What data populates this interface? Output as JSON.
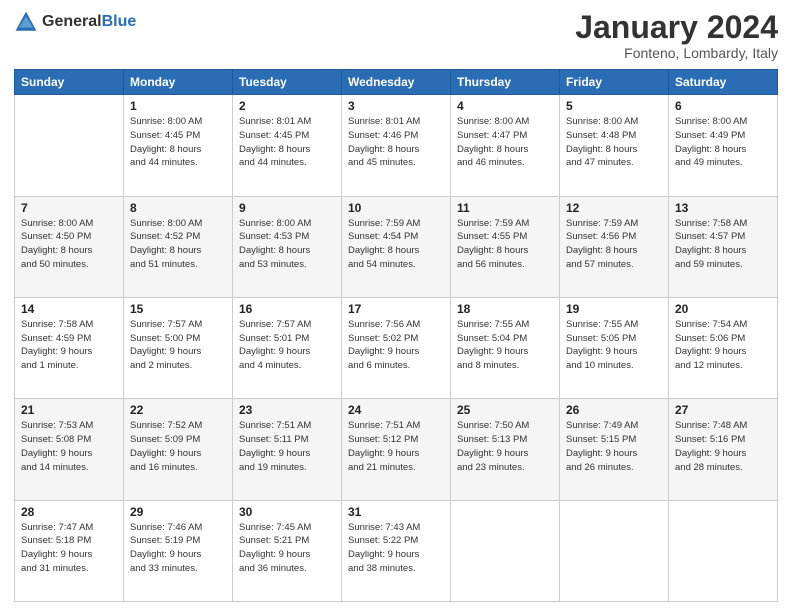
{
  "logo": {
    "general": "General",
    "blue": "Blue"
  },
  "header": {
    "month": "January 2024",
    "location": "Fonteno, Lombardy, Italy"
  },
  "weekdays": [
    "Sunday",
    "Monday",
    "Tuesday",
    "Wednesday",
    "Thursday",
    "Friday",
    "Saturday"
  ],
  "weeks": [
    [
      {
        "day": "",
        "info": ""
      },
      {
        "day": "1",
        "info": "Sunrise: 8:00 AM\nSunset: 4:45 PM\nDaylight: 8 hours\nand 44 minutes."
      },
      {
        "day": "2",
        "info": "Sunrise: 8:01 AM\nSunset: 4:45 PM\nDaylight: 8 hours\nand 44 minutes."
      },
      {
        "day": "3",
        "info": "Sunrise: 8:01 AM\nSunset: 4:46 PM\nDaylight: 8 hours\nand 45 minutes."
      },
      {
        "day": "4",
        "info": "Sunrise: 8:00 AM\nSunset: 4:47 PM\nDaylight: 8 hours\nand 46 minutes."
      },
      {
        "day": "5",
        "info": "Sunrise: 8:00 AM\nSunset: 4:48 PM\nDaylight: 8 hours\nand 47 minutes."
      },
      {
        "day": "6",
        "info": "Sunrise: 8:00 AM\nSunset: 4:49 PM\nDaylight: 8 hours\nand 49 minutes."
      }
    ],
    [
      {
        "day": "7",
        "info": "Sunrise: 8:00 AM\nSunset: 4:50 PM\nDaylight: 8 hours\nand 50 minutes."
      },
      {
        "day": "8",
        "info": "Sunrise: 8:00 AM\nSunset: 4:52 PM\nDaylight: 8 hours\nand 51 minutes."
      },
      {
        "day": "9",
        "info": "Sunrise: 8:00 AM\nSunset: 4:53 PM\nDaylight: 8 hours\nand 53 minutes."
      },
      {
        "day": "10",
        "info": "Sunrise: 7:59 AM\nSunset: 4:54 PM\nDaylight: 8 hours\nand 54 minutes."
      },
      {
        "day": "11",
        "info": "Sunrise: 7:59 AM\nSunset: 4:55 PM\nDaylight: 8 hours\nand 56 minutes."
      },
      {
        "day": "12",
        "info": "Sunrise: 7:59 AM\nSunset: 4:56 PM\nDaylight: 8 hours\nand 57 minutes."
      },
      {
        "day": "13",
        "info": "Sunrise: 7:58 AM\nSunset: 4:57 PM\nDaylight: 8 hours\nand 59 minutes."
      }
    ],
    [
      {
        "day": "14",
        "info": "Sunrise: 7:58 AM\nSunset: 4:59 PM\nDaylight: 9 hours\nand 1 minute."
      },
      {
        "day": "15",
        "info": "Sunrise: 7:57 AM\nSunset: 5:00 PM\nDaylight: 9 hours\nand 2 minutes."
      },
      {
        "day": "16",
        "info": "Sunrise: 7:57 AM\nSunset: 5:01 PM\nDaylight: 9 hours\nand 4 minutes."
      },
      {
        "day": "17",
        "info": "Sunrise: 7:56 AM\nSunset: 5:02 PM\nDaylight: 9 hours\nand 6 minutes."
      },
      {
        "day": "18",
        "info": "Sunrise: 7:55 AM\nSunset: 5:04 PM\nDaylight: 9 hours\nand 8 minutes."
      },
      {
        "day": "19",
        "info": "Sunrise: 7:55 AM\nSunset: 5:05 PM\nDaylight: 9 hours\nand 10 minutes."
      },
      {
        "day": "20",
        "info": "Sunrise: 7:54 AM\nSunset: 5:06 PM\nDaylight: 9 hours\nand 12 minutes."
      }
    ],
    [
      {
        "day": "21",
        "info": "Sunrise: 7:53 AM\nSunset: 5:08 PM\nDaylight: 9 hours\nand 14 minutes."
      },
      {
        "day": "22",
        "info": "Sunrise: 7:52 AM\nSunset: 5:09 PM\nDaylight: 9 hours\nand 16 minutes."
      },
      {
        "day": "23",
        "info": "Sunrise: 7:51 AM\nSunset: 5:11 PM\nDaylight: 9 hours\nand 19 minutes."
      },
      {
        "day": "24",
        "info": "Sunrise: 7:51 AM\nSunset: 5:12 PM\nDaylight: 9 hours\nand 21 minutes."
      },
      {
        "day": "25",
        "info": "Sunrise: 7:50 AM\nSunset: 5:13 PM\nDaylight: 9 hours\nand 23 minutes."
      },
      {
        "day": "26",
        "info": "Sunrise: 7:49 AM\nSunset: 5:15 PM\nDaylight: 9 hours\nand 26 minutes."
      },
      {
        "day": "27",
        "info": "Sunrise: 7:48 AM\nSunset: 5:16 PM\nDaylight: 9 hours\nand 28 minutes."
      }
    ],
    [
      {
        "day": "28",
        "info": "Sunrise: 7:47 AM\nSunset: 5:18 PM\nDaylight: 9 hours\nand 31 minutes."
      },
      {
        "day": "29",
        "info": "Sunrise: 7:46 AM\nSunset: 5:19 PM\nDaylight: 9 hours\nand 33 minutes."
      },
      {
        "day": "30",
        "info": "Sunrise: 7:45 AM\nSunset: 5:21 PM\nDaylight: 9 hours\nand 36 minutes."
      },
      {
        "day": "31",
        "info": "Sunrise: 7:43 AM\nSunset: 5:22 PM\nDaylight: 9 hours\nand 38 minutes."
      },
      {
        "day": "",
        "info": ""
      },
      {
        "day": "",
        "info": ""
      },
      {
        "day": "",
        "info": ""
      }
    ]
  ]
}
